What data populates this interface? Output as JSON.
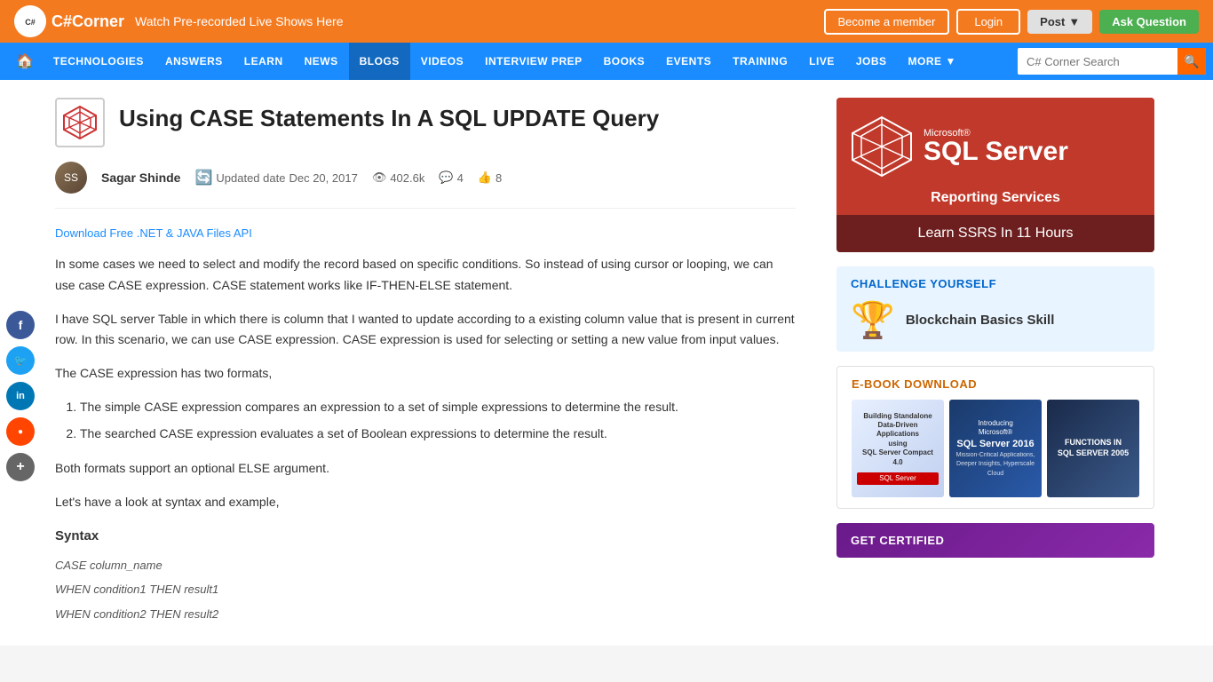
{
  "topBanner": {
    "logoText": "C#Corner",
    "promoText": "Watch Pre-recorded Live Shows Here",
    "becomeMember": "Become a member",
    "login": "Login",
    "post": "Post",
    "askQuestion": "Ask Question"
  },
  "nav": {
    "home": "⌂",
    "items": [
      {
        "label": "Technologies",
        "active": false
      },
      {
        "label": "Answers",
        "active": false
      },
      {
        "label": "Learn",
        "active": false
      },
      {
        "label": "News",
        "active": false
      },
      {
        "label": "Blogs",
        "active": true
      },
      {
        "label": "Videos",
        "active": false
      },
      {
        "label": "Interview Prep",
        "active": false
      },
      {
        "label": "Books",
        "active": false
      },
      {
        "label": "Events",
        "active": false
      },
      {
        "label": "Training",
        "active": false
      },
      {
        "label": "Live",
        "active": false
      },
      {
        "label": "Jobs",
        "active": false
      },
      {
        "label": "More",
        "active": false,
        "hasChevron": true
      }
    ],
    "searchPlaceholder": "C# Corner Search"
  },
  "social": {
    "buttons": [
      {
        "name": "facebook",
        "label": "f",
        "class": "social-fb"
      },
      {
        "name": "twitter",
        "label": "🐦",
        "class": "social-tw"
      },
      {
        "name": "linkedin",
        "label": "in",
        "class": "social-li"
      },
      {
        "name": "reddit",
        "label": "🔴",
        "class": "social-rd"
      },
      {
        "name": "more",
        "label": "+",
        "class": "social-more"
      }
    ]
  },
  "article": {
    "title": "Using CASE Statements In A SQL UPDATE Query",
    "author": {
      "name": "Sagar Shinde",
      "initials": "SS"
    },
    "updatedLabel": "Updated date",
    "updatedDate": "Dec 20, 2017",
    "views": "402.6k",
    "comments": "4",
    "likes": "8",
    "downloadLink": "Download Free .NET & JAVA Files API",
    "paragraphs": [
      "In some cases we need to select and modify the record based on specific conditions. So instead of using cursor or looping, we can use case CASE expression. CASE statement works like IF-THEN-ELSE statement.",
      "I have SQL server Table in which there is column that I wanted to update according to a existing column value that is present in current row. In this scenario, we can use CASE expression. CASE expression is used for selecting or setting a new value from input values.",
      "The CASE expression has two formats,"
    ],
    "listItems": [
      "The simple CASE expression compares an expression to a set of simple expressions to determine the result.",
      "The searched CASE expression evaluates a set of Boolean expressions to determine the result."
    ],
    "paragraphAfterList": "Both formats support an optional ELSE argument.",
    "paragraphExample": "Let's have a look at syntax and example,",
    "syntaxTitle": "Syntax",
    "codeLines": [
      "CASE column_name",
      "WHEN condition1 THEN result1",
      "WHEN condition2 THEN result2"
    ]
  },
  "sidebar": {
    "sqlAd": {
      "microsoft": "Microsoft®",
      "serverText": "SQL Server",
      "reporting": "Reporting Services",
      "learnText": "Learn SSRS In 11 Hours"
    },
    "challenge": {
      "title": "CHALLENGE YOURSELF",
      "skill": "Blockchain Basics Skill",
      "trophy": "🏆"
    },
    "ebook": {
      "title": "E-BOOK DOWNLOAD",
      "books": [
        {
          "line1": "Building Standalone",
          "line2": "Data-Driven Applications",
          "line3": "using",
          "line4": "SQL Server Compact 4.0",
          "line5": "SQL Server"
        },
        {
          "line1": "Introducing",
          "line2": "Microsoft®",
          "line3": "SQL Server 2016",
          "line4": "Mission-Critical Applications, Deeper Insights, Hyperscale Cloud"
        },
        {
          "line1": "FUNCTIONS IN",
          "line2": "SQL SERVER 2005"
        }
      ]
    },
    "getCertified": {
      "title": "GET CERTIFIED"
    }
  }
}
